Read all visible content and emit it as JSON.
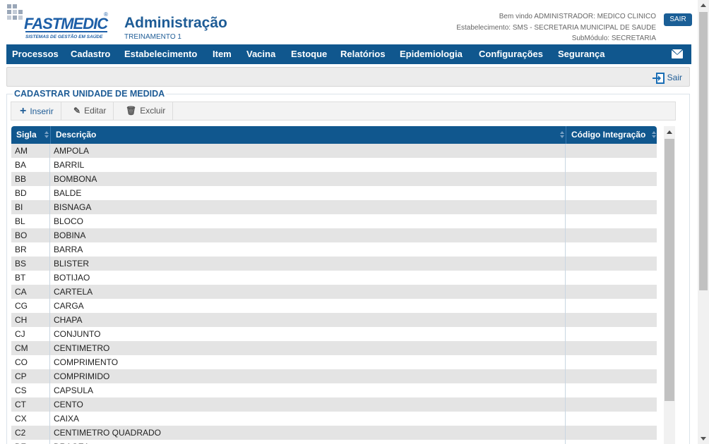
{
  "header": {
    "logo_brand": "FASTMEDIC",
    "logo_tagline": "SISTEMAS DE GESTÃO EM SAÚDE",
    "logo_reg": "®",
    "title": "Administração",
    "subtitle": "TREINAMENTO 1",
    "welcome": "Bem vindo ADMINISTRADOR: MEDICO CLINICO",
    "establishment": "Estabelecimento: SMS - SECRETARIA MUNICIPAL DE SAUDE",
    "submodule": "SubMódulo: SECRETARIA",
    "logout_label": "SAIR"
  },
  "nav": {
    "items": [
      {
        "label": "Processos"
      },
      {
        "label": "Cadastro"
      },
      {
        "label": "Estabelecimento"
      },
      {
        "label": "Item"
      },
      {
        "label": "Vacina"
      },
      {
        "label": "Estoque"
      },
      {
        "label": "Relatórios"
      },
      {
        "label": "Epidemiologia"
      },
      {
        "label": "Configurações"
      },
      {
        "label": "Segurança"
      }
    ],
    "mail_icon": "envelope-icon"
  },
  "action_bar": {
    "exit_label": "Sair",
    "exit_icon": "sign-out-icon"
  },
  "panel": {
    "title": "CADASTRAR UNIDADE DE MEDIDA"
  },
  "toolbar": {
    "insert_label": "Inserir",
    "edit_label": "Editar",
    "delete_label": "Excluir"
  },
  "grid": {
    "columns": [
      "Sigla",
      "Descrição",
      "Código Integração"
    ],
    "rows": [
      {
        "sigla": "AM",
        "descricao": "AMPOLA",
        "codigo": ""
      },
      {
        "sigla": "BA",
        "descricao": "BARRIL",
        "codigo": ""
      },
      {
        "sigla": "BB",
        "descricao": "BOMBONA",
        "codigo": ""
      },
      {
        "sigla": "BD",
        "descricao": "BALDE",
        "codigo": ""
      },
      {
        "sigla": "BI",
        "descricao": "BISNAGA",
        "codigo": ""
      },
      {
        "sigla": "BL",
        "descricao": "BLOCO",
        "codigo": ""
      },
      {
        "sigla": "BO",
        "descricao": "BOBINA",
        "codigo": ""
      },
      {
        "sigla": "BR",
        "descricao": "BARRA",
        "codigo": ""
      },
      {
        "sigla": "BS",
        "descricao": "BLISTER",
        "codigo": ""
      },
      {
        "sigla": "BT",
        "descricao": "BOTIJAO",
        "codigo": ""
      },
      {
        "sigla": "CA",
        "descricao": "CARTELA",
        "codigo": ""
      },
      {
        "sigla": "CG",
        "descricao": "CARGA",
        "codigo": ""
      },
      {
        "sigla": "CH",
        "descricao": "CHAPA",
        "codigo": ""
      },
      {
        "sigla": "CJ",
        "descricao": "CONJUNTO",
        "codigo": ""
      },
      {
        "sigla": "CM",
        "descricao": "CENTIMETRO",
        "codigo": ""
      },
      {
        "sigla": "CO",
        "descricao": "COMPRIMENTO",
        "codigo": ""
      },
      {
        "sigla": "CP",
        "descricao": "COMPRIMIDO",
        "codigo": ""
      },
      {
        "sigla": "CS",
        "descricao": "CAPSULA",
        "codigo": ""
      },
      {
        "sigla": "CT",
        "descricao": "CENTO",
        "codigo": ""
      },
      {
        "sigla": "CX",
        "descricao": "CAIXA",
        "codigo": ""
      },
      {
        "sigla": "C2",
        "descricao": "CENTIMETRO QUADRADO",
        "codigo": ""
      },
      {
        "sigla": "DZ",
        "descricao": "DRAGEA",
        "codigo": ""
      }
    ]
  },
  "colors": {
    "primary": "#10578e",
    "title": "#1e5c96",
    "row_alt": "#e4e4e4"
  }
}
